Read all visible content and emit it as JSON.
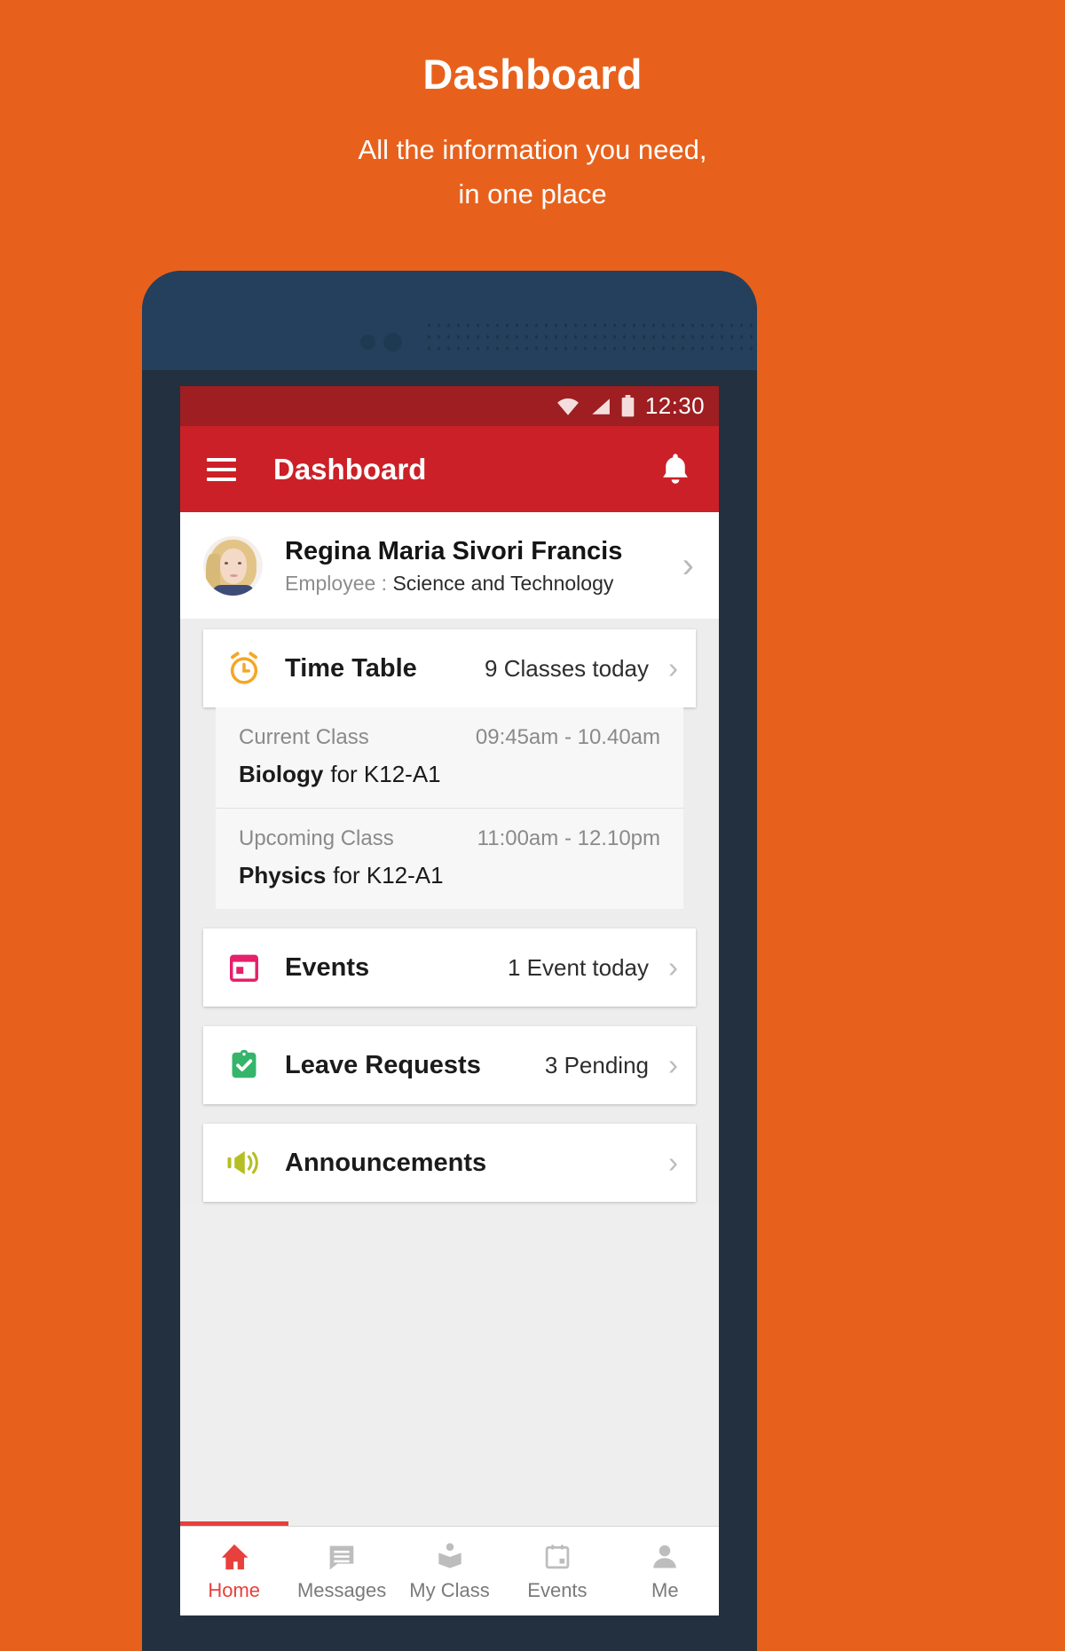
{
  "promo": {
    "title": "Dashboard",
    "subtitle_line1": "All the information you need,",
    "subtitle_line2": "in one place"
  },
  "colors": {
    "background": "#E8611C",
    "statusbar": "#9E1E22",
    "appbar": "#CB2027",
    "accent_red": "#E8403C",
    "timetable_icon": "#F5A623",
    "events_icon": "#E6206B",
    "leave_icon": "#34B56A",
    "announcements_icon": "#B5BE23",
    "phone_body": "#22303F",
    "phone_top": "#24405C"
  },
  "statusbar": {
    "time": "12:30",
    "icons": [
      "wifi-icon",
      "signal-icon",
      "battery-icon"
    ]
  },
  "appbar": {
    "menu_icon": "hamburger-menu-icon",
    "title": "Dashboard",
    "notification_icon": "bell-icon"
  },
  "profile": {
    "name": "Regina Maria Sivori Francis",
    "role_label": "Employee :",
    "department": "Science and Technology",
    "chevron": "›"
  },
  "cards": [
    {
      "id": "time-table",
      "icon": "alarm-clock-icon",
      "label": "Time Table",
      "meta": "9 Classes today",
      "chevron": "›"
    },
    {
      "id": "events",
      "icon": "calendar-icon",
      "label": "Events",
      "meta": "1 Event today",
      "chevron": "›"
    },
    {
      "id": "leave-requests",
      "icon": "clipboard-check-icon",
      "label": "Leave Requests",
      "meta": "3 Pending",
      "chevron": "›"
    },
    {
      "id": "announcements",
      "icon": "megaphone-icon",
      "label": "Announcements",
      "meta": "",
      "chevron": "›"
    }
  ],
  "timetable_detail": [
    {
      "kind": "Current Class",
      "time": "09:45am - 10.40am",
      "subject": "Biology",
      "section": "for K12-A1"
    },
    {
      "kind": "Upcoming Class",
      "time": "11:00am - 12.10pm",
      "subject": "Physics",
      "section": "for K12-A1"
    }
  ],
  "bottom_nav": {
    "items": [
      {
        "label": "Home",
        "icon": "home-icon",
        "active": true
      },
      {
        "label": "Messages",
        "icon": "message-icon",
        "active": false
      },
      {
        "label": "My Class",
        "icon": "book-icon",
        "active": false
      },
      {
        "label": "Events",
        "icon": "calendar-icon",
        "active": false
      },
      {
        "label": "Me",
        "icon": "person-icon",
        "active": false
      }
    ]
  }
}
